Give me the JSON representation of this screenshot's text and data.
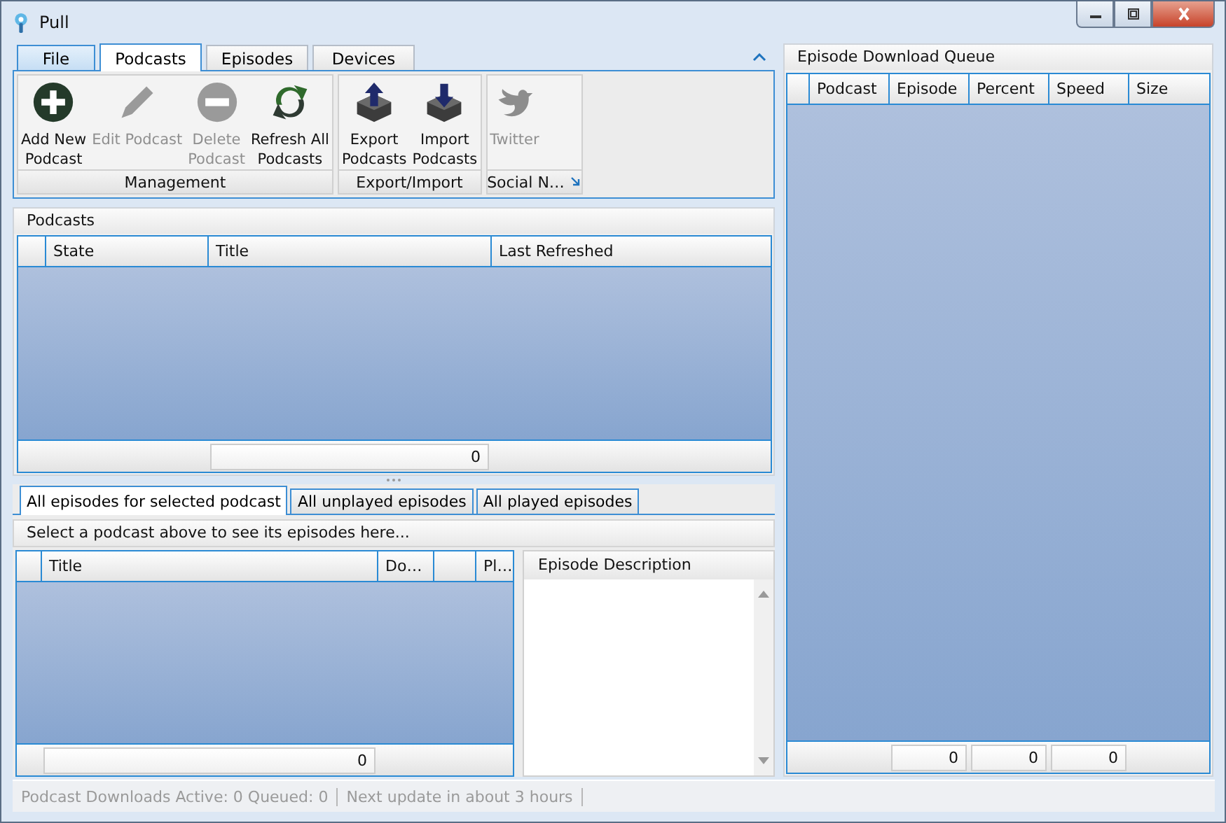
{
  "window": {
    "title": "Pull"
  },
  "ribbon": {
    "expanded": true,
    "tabs": [
      {
        "label": "File",
        "kind": "file",
        "selected": false
      },
      {
        "label": "Podcasts",
        "kind": "tab",
        "selected": true
      },
      {
        "label": "Episodes",
        "kind": "tab",
        "selected": false
      },
      {
        "label": "Devices",
        "kind": "tab",
        "selected": false
      }
    ],
    "groups": [
      {
        "label": "Management",
        "launcher": false,
        "buttons": [
          {
            "label": "Add New\nPodcast",
            "kind": "add",
            "disabled": false
          },
          {
            "label": "Edit Podcast",
            "kind": "edit",
            "disabled": true
          },
          {
            "label": "Delete\nPodcast",
            "kind": "delete",
            "disabled": true
          },
          {
            "label": "Refresh All\nPodcasts",
            "kind": "refresh",
            "disabled": false
          }
        ]
      },
      {
        "label": "Export/Import",
        "launcher": false,
        "buttons": [
          {
            "label": "Export\nPodcasts",
            "kind": "export",
            "disabled": false
          },
          {
            "label": "Import\nPodcasts",
            "kind": "import",
            "disabled": false
          }
        ]
      },
      {
        "label": "Social N…",
        "launcher": true,
        "buttons": [
          {
            "label": "Twitter",
            "kind": "bird",
            "disabled": true
          }
        ]
      }
    ]
  },
  "podcasts": {
    "title": "Podcasts",
    "columns": [
      {
        "label": "State"
      },
      {
        "label": "Title",
        "summary": "0"
      },
      {
        "label": "Last Refreshed"
      }
    ]
  },
  "episodes": {
    "tabs": [
      {
        "label": "All episodes for selected podcast",
        "selected": true
      },
      {
        "label": "All unplayed episodes",
        "selected": false
      },
      {
        "label": "All played episodes",
        "selected": false
      }
    ],
    "hint": "Select a podcast above to see its episodes here...",
    "columns": [
      {
        "label": "Title",
        "summary": "0"
      },
      {
        "label": "Do…"
      },
      {},
      {
        "label": "Pl…"
      }
    ],
    "description_title": "Episode Description"
  },
  "queue": {
    "title": "Episode Download Queue",
    "columns": [
      {
        "label": "Podcast"
      },
      {
        "label": "Episode",
        "summary": "0"
      },
      {
        "label": "Percent",
        "summary": "0"
      },
      {
        "label": "Speed",
        "summary": "0"
      },
      {
        "label": "Size"
      }
    ]
  },
  "status_bar": [
    "Podcast Downloads Active: 0 Queued: 0",
    "Next update in about 3 hours"
  ]
}
